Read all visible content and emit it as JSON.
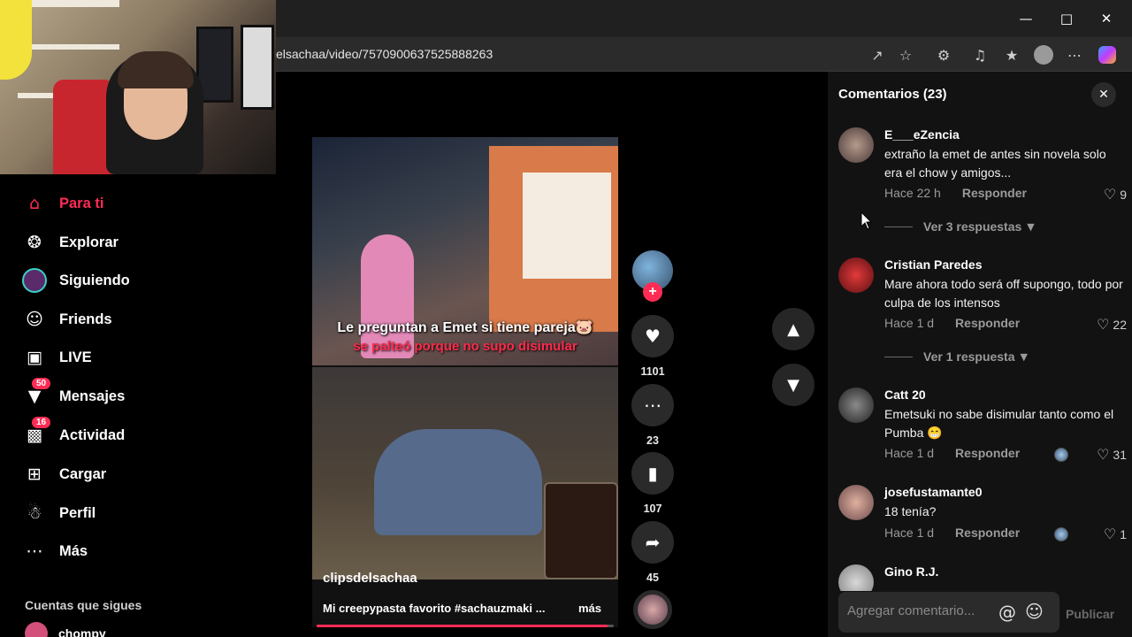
{
  "browser": {
    "url": "elsachaa/video/7570900637525888263",
    "minimize_icon": "minimize-icon",
    "maximize_icon": "maximize-icon",
    "close_icon": "close-icon"
  },
  "sidebar": {
    "items": [
      {
        "label": "Para ti",
        "icon": "home-icon",
        "active": true
      },
      {
        "label": "Explorar",
        "icon": "compass-icon"
      },
      {
        "label": "Siguiendo",
        "icon": "following-avatar-icon"
      },
      {
        "label": "Friends",
        "icon": "friends-icon"
      },
      {
        "label": "LIVE",
        "icon": "live-tv-icon"
      },
      {
        "label": "Mensajes",
        "icon": "messages-icon",
        "badge": "50"
      },
      {
        "label": "Actividad",
        "icon": "inbox-icon",
        "badge": "16"
      },
      {
        "label": "Cargar",
        "icon": "upload-plus-icon"
      },
      {
        "label": "Perfil",
        "icon": "profile-icon"
      },
      {
        "label": "Más",
        "icon": "more-dots-icon"
      }
    ],
    "following_header": "Cuentas que sigues",
    "following": [
      {
        "name": "chompy"
      }
    ]
  },
  "video": {
    "caption_line1": "Le preguntan a Emet si tiene pareja🐷",
    "caption_line2": "se palteó porque no supo disimular",
    "author": "clipsdelsachaa",
    "description": "Mi creepypasta favorito #sachauzmaki ...",
    "more_label": "más",
    "progress": 0.98
  },
  "actions": {
    "likes": "1101",
    "comments": "23",
    "saves": "107",
    "shares": "45"
  },
  "comments_panel": {
    "title": "Comentarios (23)",
    "input_placeholder": "Agregar comentario...",
    "post_label": "Publicar",
    "comments": [
      {
        "user": "E___eZencia",
        "text": "extraño la emet de antes sin novela solo era el chow y amigos...",
        "time": "Hace 22 h",
        "reply": "Responder",
        "likes": "9",
        "view_replies": "Ver 3 respuestas"
      },
      {
        "user": "Cristian Paredes",
        "text": "Mare ahora todo será off supongo, todo por culpa de los intensos",
        "time": "Hace 1 d",
        "reply": "Responder",
        "likes": "22",
        "view_replies": "Ver 1 respuesta"
      },
      {
        "user": "Catt 20",
        "text": "Emetsuki no sabe disimular tanto como el Pumba 😁",
        "time": "Hace 1 d",
        "reply": "Responder",
        "likes": "31"
      },
      {
        "user": "josefustamante0",
        "text": "18 tenía?",
        "time": "Hace 1 d",
        "reply": "Responder",
        "likes": "1"
      },
      {
        "user": "Gino R.J."
      }
    ]
  },
  "colors": {
    "accent": "#fe2c55",
    "background": "#000000",
    "panel": "#121212"
  }
}
